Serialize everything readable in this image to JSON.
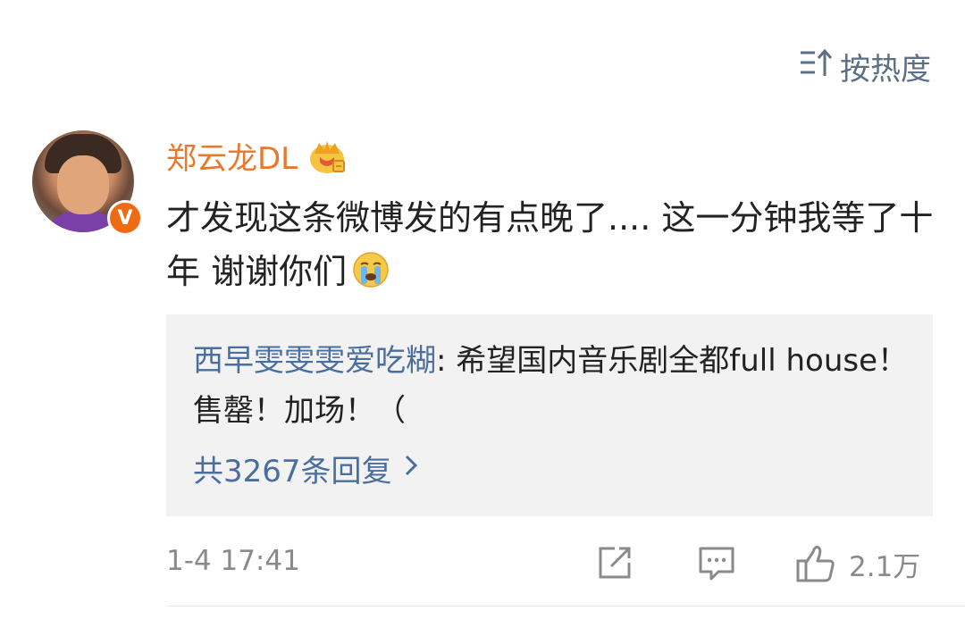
{
  "sort": {
    "label": "按热度"
  },
  "comment": {
    "username": "郑云龙DL",
    "verified_badge": "V",
    "text": "才发现这条微博发的有点晚了.... 这一分钟我等了十年 谢谢你们",
    "emoji": "crying-face-icon"
  },
  "reply": {
    "username": "西早雯雯雯爱吃糊",
    "separator": ": ",
    "text": "希望国内音乐剧全都full house！售罄！加场！（",
    "count_label": "共3267条回复"
  },
  "footer": {
    "time": "1-4 17:41",
    "likes": "2.1万"
  },
  "colors": {
    "username": "#e8792b",
    "link": "#4a6f9e",
    "muted": "#8a8a8a",
    "verified": "#f06a12"
  }
}
